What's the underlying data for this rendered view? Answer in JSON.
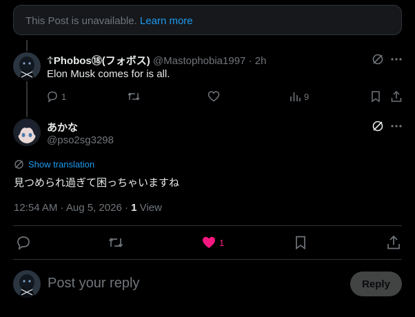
{
  "unavailable": {
    "text": "This Post is unavailable.",
    "link": "Learn more"
  },
  "parent_post": {
    "display_name": "☦Phobos⑱(フォボス)",
    "handle": "@Mastophobia1997",
    "separator": "·",
    "time": "2h",
    "text": "Elon Musk comes for is all.",
    "reply_count": "1",
    "views_count": "9"
  },
  "main_post": {
    "display_name": "あかな",
    "handle": "@pso2sg3298",
    "show_translation": "Show translation",
    "text": "見つめられ過ぎて困っちゃいますね",
    "timestamp": "12:54 AM · Aug 5, 2026 · ",
    "views_num": "1",
    "views_label": " View",
    "like_count": "1"
  },
  "reply_box": {
    "placeholder": "Post your reply",
    "button": "Reply"
  },
  "colors": {
    "accent": "#1d9bf0",
    "like": "#f91880",
    "muted": "#71767b",
    "border": "#2f3336"
  }
}
